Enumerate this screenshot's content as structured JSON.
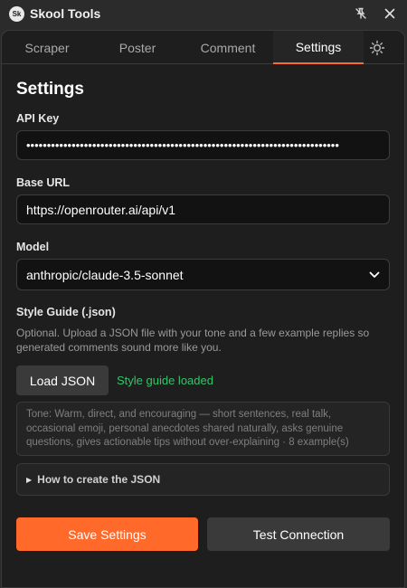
{
  "window": {
    "title": "Skool Tools",
    "logo_text": "Sk",
    "icons": {
      "logo": "skool-logo",
      "pin": "pin-off-icon",
      "close": "close-icon"
    }
  },
  "tabs": [
    {
      "label": "Scraper",
      "active": false
    },
    {
      "label": "Poster",
      "active": false
    },
    {
      "label": "Comment",
      "active": false
    },
    {
      "label": "Settings",
      "active": true
    }
  ],
  "theme_toggle": {
    "icon": "sun-icon"
  },
  "settings": {
    "heading": "Settings",
    "api_key": {
      "label": "API Key",
      "value": "••••••••••••••••••••••••••••••••••••••••••••••••••••••••••••••••••••••••••••"
    },
    "base_url": {
      "label": "Base URL",
      "value": "https://openrouter.ai/api/v1"
    },
    "model": {
      "label": "Model",
      "selected": "anthropic/claude-3.5-sonnet"
    },
    "style_guide": {
      "label": "Style Guide (.json)",
      "description": "Optional. Upload a JSON file with your tone and a few example replies so generated comments sound more like you.",
      "load_button": "Load JSON",
      "status": "Style guide loaded",
      "preview": "Tone: Warm, direct, and encouraging — short sentences, real talk, occasional emoji, personal anecdotes shared naturally, asks genuine questions, gives actionable tips without over-explaining · 8 example(s)",
      "help_toggle": "How to create the JSON"
    },
    "buttons": {
      "save": "Save Settings",
      "test": "Test Connection"
    }
  },
  "colors": {
    "accent": "#ff6a2b",
    "success": "#35c46a",
    "background": "#1e1e1e",
    "titlebar": "#2b2b2b"
  }
}
